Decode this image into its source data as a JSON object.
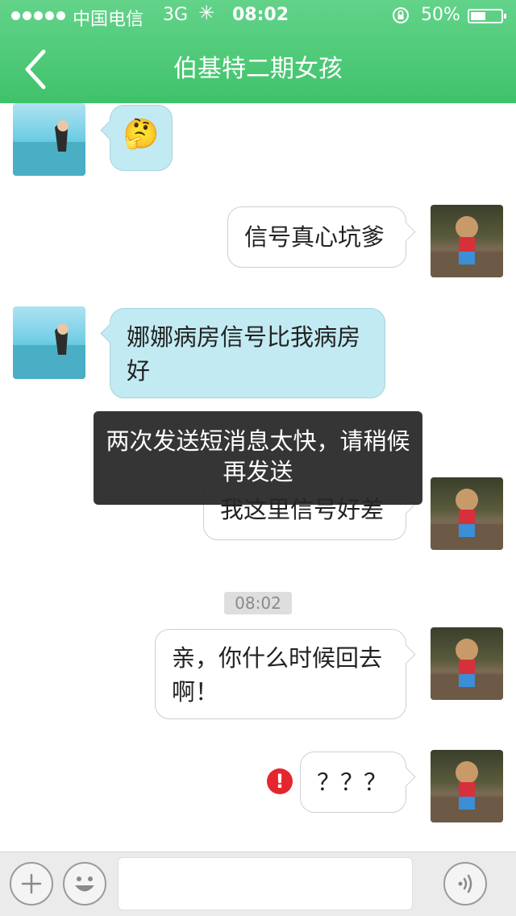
{
  "status_bar": {
    "carrier": "中国电信",
    "network": "3G",
    "time": "08:02",
    "battery_percent": "50%",
    "battery_level": 0.5
  },
  "header": {
    "title": "伯基特二期女孩",
    "back_icon": "chevron-left-icon",
    "background_color": "#4cc774"
  },
  "messages": [
    {
      "side": "incoming",
      "type": "emoji",
      "emoji": "🤔"
    },
    {
      "side": "outgoing",
      "text": "信号真心坑爹"
    },
    {
      "side": "incoming",
      "text": "娜娜病房信号比我病房好"
    },
    {
      "side": "outgoing",
      "text": "我这里信号好差"
    },
    {
      "timestamp": "08:02"
    },
    {
      "side": "outgoing",
      "text": "亲，你什么时候回去啊！"
    },
    {
      "side": "outgoing",
      "text": "？？？",
      "status": "failed",
      "status_icon": "error-icon",
      "status_text": "!"
    }
  ],
  "toast": {
    "text": "两次发送短消息太快，请稍候再发送"
  },
  "input_bar": {
    "plus_icon": "plus-icon",
    "emoji_icon": "smiley-icon",
    "voice_icon": "voice-icon",
    "input_value": ""
  },
  "colors": {
    "incoming_bubble": "#c2eaf2",
    "outgoing_bubble": "#ffffff",
    "error": "#e5262e"
  }
}
